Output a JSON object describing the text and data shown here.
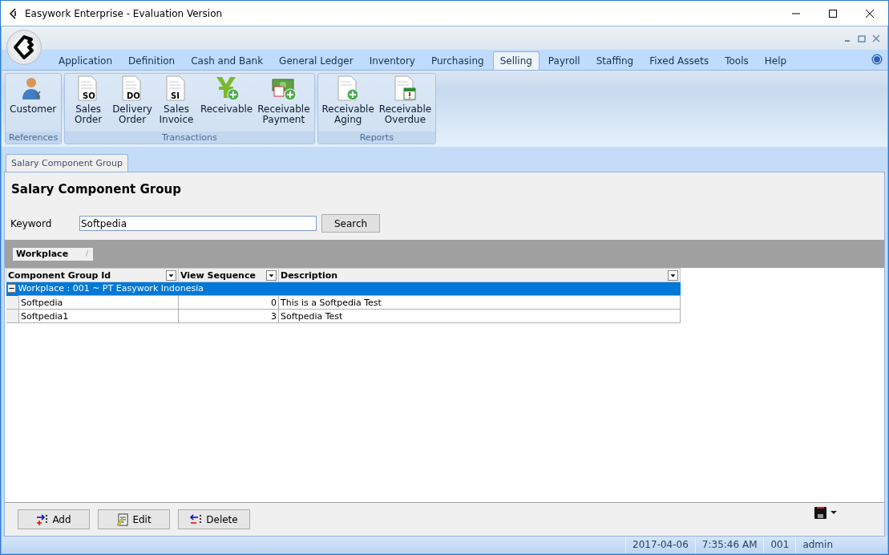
{
  "window": {
    "title": "Easywork Enterprise - Evaluation Version"
  },
  "ribbon_tabs": [
    {
      "label": "Application",
      "selected": false
    },
    {
      "label": "Definition",
      "selected": false
    },
    {
      "label": "Cash and Bank",
      "selected": false
    },
    {
      "label": "General Ledger",
      "selected": false
    },
    {
      "label": "Inventory",
      "selected": false
    },
    {
      "label": "Purchasing",
      "selected": false
    },
    {
      "label": "Selling",
      "selected": true
    },
    {
      "label": "Payroll",
      "selected": false
    },
    {
      "label": "Staffing",
      "selected": false
    },
    {
      "label": "Fixed Assets",
      "selected": false
    },
    {
      "label": "Tools",
      "selected": false
    },
    {
      "label": "Help",
      "selected": false
    }
  ],
  "ribbon_groups": [
    {
      "title": "References",
      "items": [
        {
          "kind": "customer",
          "label": "Customer"
        }
      ]
    },
    {
      "title": "Transactions",
      "items": [
        {
          "kind": "document",
          "code": "SO",
          "label": "Sales\nOrder"
        },
        {
          "kind": "document",
          "code": "DO",
          "label": "Delivery\nOrder"
        },
        {
          "kind": "document",
          "code": "SI",
          "label": "Sales\nInvoice"
        },
        {
          "kind": "yen",
          "label": "Receivable"
        },
        {
          "kind": "payment",
          "label": "Receivable\nPayment"
        }
      ]
    },
    {
      "title": "Reports",
      "items": [
        {
          "kind": "doc-plus",
          "label": "Receivable\nAging"
        },
        {
          "kind": "doc-alert",
          "label": "Receivable\nOverdue"
        }
      ]
    }
  ],
  "document_tabs": [
    {
      "label": "Salary Component Group",
      "selected": true
    }
  ],
  "page": {
    "heading": "Salary Component Group",
    "keyword_label": "Keyword",
    "keyword_value": "Softpedia",
    "search_button": "Search"
  },
  "group_panel": {
    "chip": "Workplace",
    "sort_mark": "/"
  },
  "table": {
    "columns": [
      "Component Group Id",
      "View Sequence",
      "Description"
    ],
    "groups": [
      {
        "label": "Workplace : 001 ~ PT Easywork Indonesia",
        "expanded": true,
        "selected": true,
        "rows": [
          [
            "Softpedia",
            "0",
            "This is a Softpedia Test"
          ],
          [
            "Softpedia1",
            "3",
            "Softpedia Test"
          ]
        ]
      }
    ]
  },
  "buttons": [
    {
      "kind": "add",
      "label": "Add"
    },
    {
      "kind": "edit",
      "label": "Edit"
    },
    {
      "kind": "delete",
      "label": "Delete"
    }
  ],
  "status_bar": [
    "2017-04-06",
    "7:35:46 AM",
    "001",
    "admin"
  ]
}
